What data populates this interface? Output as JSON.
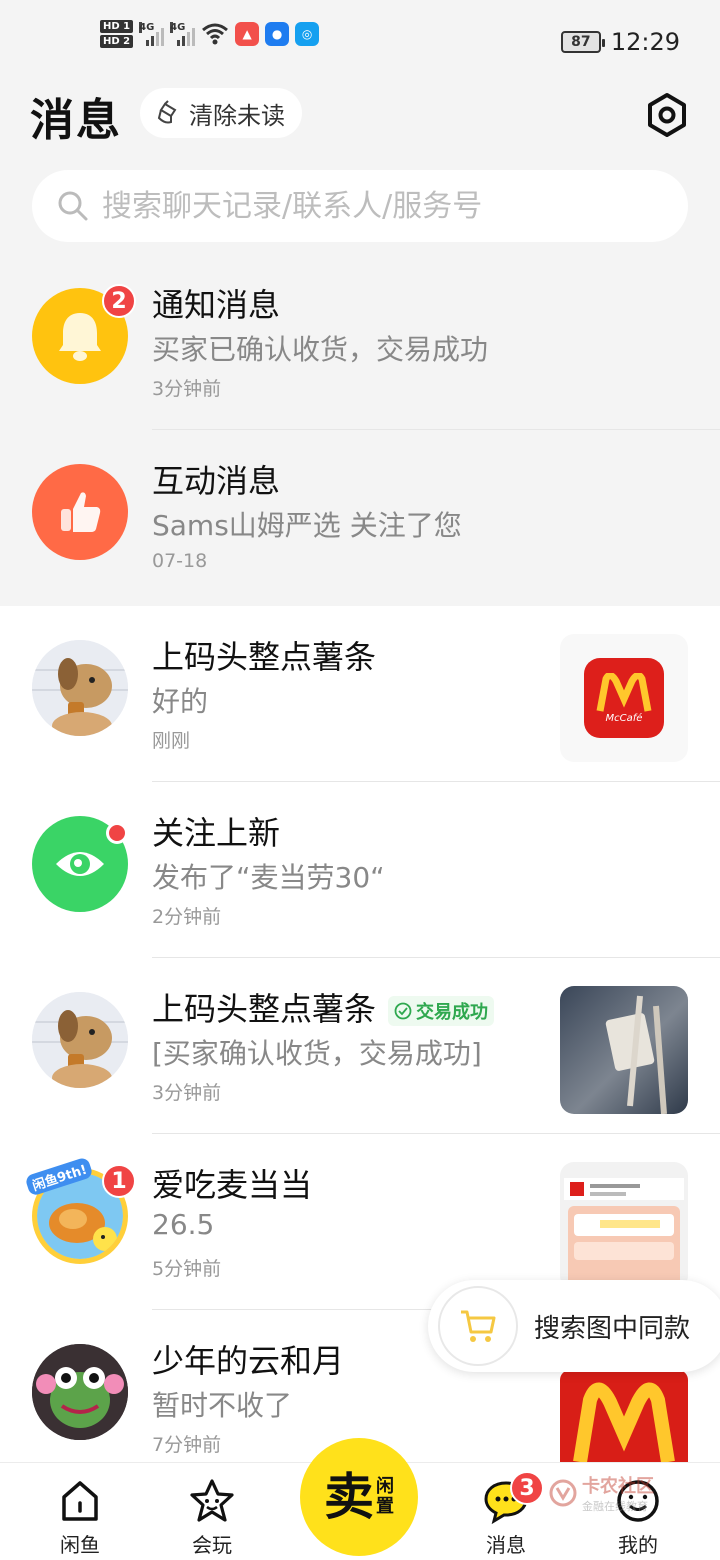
{
  "status_bar": {
    "hd1": "HD 1",
    "hd2": "HD 2",
    "net1": "4G",
    "net2": "4G",
    "battery": "87",
    "time": "12:29"
  },
  "header": {
    "title": "消息",
    "clear_label": "清除未读"
  },
  "search": {
    "placeholder": "搜索聊天记录/联系人/服务号"
  },
  "conversations": [
    {
      "name": "通知消息",
      "message": "买家已确认收货，交易成功",
      "time": "3分钟前",
      "badge": "2"
    },
    {
      "name": "互动消息",
      "message": "Sams山姆严选 关注了您",
      "time": "07-18"
    },
    {
      "name": "上码头整点薯条",
      "message": "好的",
      "time": "刚刚",
      "thumb_text": "McCafé"
    },
    {
      "name": "关注上新",
      "message": "发布了“麦当劳30“",
      "time": "2分钟前"
    },
    {
      "name": "上码头整点薯条",
      "tag": "交易成功",
      "message": "[买家确认收货，交易成功]",
      "time": "3分钟前"
    },
    {
      "name": "爱吃麦当当",
      "message": "26.5",
      "time": "5分钟前",
      "badge": "1",
      "avatar_text": "闲鱼9th!"
    },
    {
      "name": "少年的云和月",
      "message": "暂时不收了",
      "time": "7分钟前"
    }
  ],
  "float_action": {
    "label": "搜索图中同款"
  },
  "tabbar": {
    "home": "闲鱼",
    "play": "会玩",
    "sell_big": "卖",
    "sell_small_1": "闲",
    "sell_small_2": "置",
    "messages": "消息",
    "messages_badge": "3",
    "mine": "我的"
  },
  "watermark": {
    "line1": "卡农社区",
    "line2": "金融在线教育"
  },
  "colors": {
    "accent_yellow": "#ffe11b",
    "badge_red": "#f04444",
    "notify_yellow": "#ffc30f",
    "interact_orange": "#ff6a46",
    "follow_green": "#3ad466",
    "success_green": "#2fa84f"
  }
}
